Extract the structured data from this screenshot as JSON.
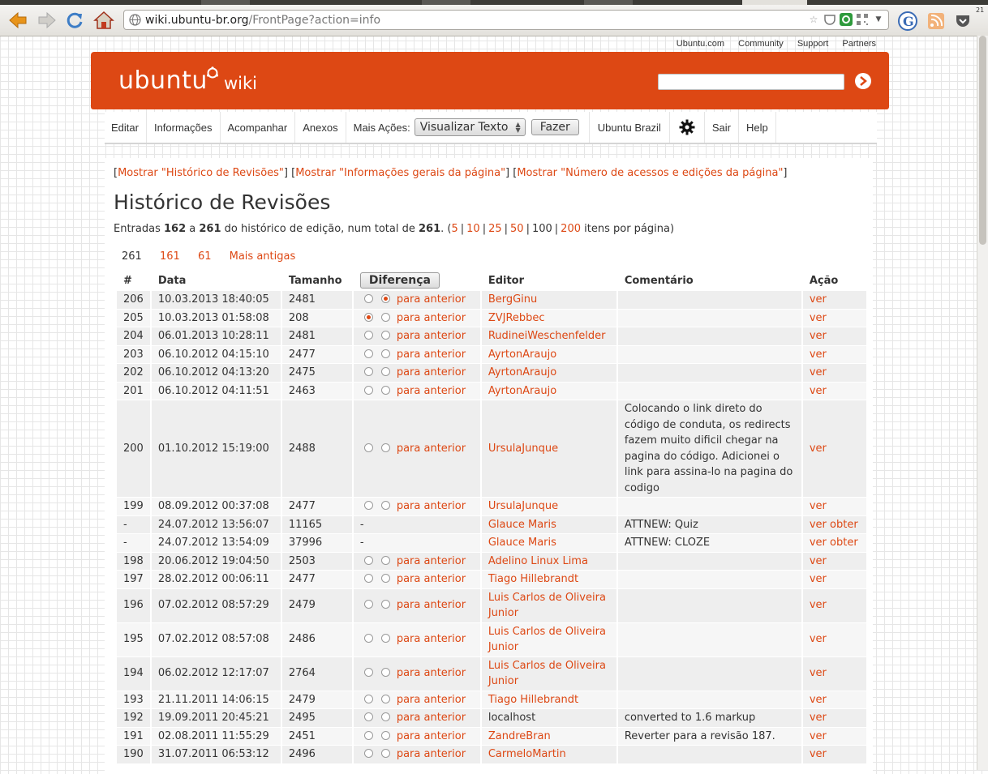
{
  "browser": {
    "url_host": "wiki.ubuntu-br.org",
    "url_path": "/FrontPage?action=info",
    "corner_number": "21"
  },
  "top_links": [
    "Ubuntu.com",
    "Community",
    "Support",
    "Partners"
  ],
  "header": {
    "logo_text": "ubuntu",
    "logo_suffix": "wiki",
    "search_value": ""
  },
  "actionbar": {
    "edit": "Editar",
    "info": "Informações",
    "subscribe": "Acompanhar",
    "attachments": "Anexos",
    "more_actions_label": "Mais Ações:",
    "more_actions_selected": "Visualizar Texto",
    "go_button": "Fazer",
    "ubuntu_brazil": "Ubuntu Brazil",
    "logout": "Sair",
    "help": "Help"
  },
  "content": {
    "toggle_links": [
      "Mostrar \"Histórico de Revisões\"",
      "Mostrar \"Informações gerais da página\"",
      "Mostrar \"Número de acessos e edições da página\""
    ],
    "title": "Histórico de Revisões",
    "entries": {
      "prefix": "Entradas",
      "from": "162",
      "a": "a",
      "to": "261",
      "middle": "do histórico de edição, num total de",
      "total": "261",
      "per_page_options": [
        "5",
        "10",
        "25",
        "50",
        "100",
        "200"
      ],
      "suffix": "itens por página)"
    },
    "pager": {
      "current": "261",
      "p1": "161",
      "p2": "61",
      "older": "Mais antigas"
    },
    "table": {
      "headers": {
        "num": "#",
        "date": "Data",
        "size": "Tamanho",
        "diff_button": "Diferença",
        "editor": "Editor",
        "comment": "Comentário",
        "action": "Ação"
      },
      "diff_label": "para anterior",
      "rows": [
        {
          "num": "206",
          "date": "10.03.2013 18:40:05",
          "size": "2481",
          "editor": "BergGinu",
          "comment": "",
          "action": "ver"
        },
        {
          "num": "205",
          "date": "10.03.2013 01:58:08",
          "size": "208",
          "editor": "ZVJRebbec",
          "comment": "",
          "action": "ver"
        },
        {
          "num": "204",
          "date": "06.01.2013 10:28:11",
          "size": "2481",
          "editor": "RudineiWeschenfelder",
          "comment": "",
          "action": "ver"
        },
        {
          "num": "203",
          "date": "06.10.2012 04:15:10",
          "size": "2477",
          "editor": "AyrtonAraujo",
          "comment": "",
          "action": "ver"
        },
        {
          "num": "202",
          "date": "06.10.2012 04:13:20",
          "size": "2475",
          "editor": "AyrtonAraujo",
          "comment": "",
          "action": "ver"
        },
        {
          "num": "201",
          "date": "06.10.2012 04:11:51",
          "size": "2463",
          "editor": "AyrtonAraujo",
          "comment": "",
          "action": "ver"
        },
        {
          "num": "200",
          "date": "01.10.2012 15:19:00",
          "size": "2488",
          "editor": "UrsulaJunque",
          "comment": "Colocando o link direto do código de conduta, os redirects fazem muito dificil chegar na pagina do código. Adicionei o link para assina-lo na pagina do codigo",
          "action": "ver"
        },
        {
          "num": "199",
          "date": "08.09.2012 00:37:08",
          "size": "2477",
          "editor": "UrsulaJunque",
          "comment": "",
          "action": "ver"
        },
        {
          "num": "-",
          "date": "24.07.2012 13:56:07",
          "size": "11165",
          "editor": "Glauce Maris",
          "comment": "ATTNEW: Quiz",
          "action": "ver",
          "action2": "obter"
        },
        {
          "num": "-",
          "date": "24.07.2012 13:54:09",
          "size": "37996",
          "editor": "Glauce Maris",
          "comment": "ATTNEW: CLOZE",
          "action": "ver",
          "action2": "obter"
        },
        {
          "num": "198",
          "date": "20.06.2012 19:04:50",
          "size": "2503",
          "editor": "Adelino Linux Lima",
          "comment": "",
          "action": "ver"
        },
        {
          "num": "197",
          "date": "28.02.2012 00:06:11",
          "size": "2477",
          "editor": "Tiago Hillebrandt",
          "comment": "",
          "action": "ver"
        },
        {
          "num": "196",
          "date": "07.02.2012 08:57:29",
          "size": "2479",
          "editor": "Luis Carlos de Oliveira Junior",
          "comment": "",
          "action": "ver"
        },
        {
          "num": "195",
          "date": "07.02.2012 08:57:08",
          "size": "2486",
          "editor": "Luis Carlos de Oliveira Junior",
          "comment": "",
          "action": "ver"
        },
        {
          "num": "194",
          "date": "06.02.2012 12:17:07",
          "size": "2764",
          "editor": "Luis Carlos de Oliveira Junior",
          "comment": "",
          "action": "ver"
        },
        {
          "num": "193",
          "date": "21.11.2011 14:06:15",
          "size": "2479",
          "editor": "Tiago Hillebrandt",
          "comment": "",
          "action": "ver"
        },
        {
          "num": "192",
          "date": "19.09.2011 20:45:21",
          "size": "2495",
          "editor": "localhost",
          "comment": "converted to 1.6 markup",
          "action": "ver"
        },
        {
          "num": "191",
          "date": "02.08.2011 11:55:29",
          "size": "2451",
          "editor": "ZandreBran",
          "comment": "Reverter para a revisão 187.",
          "action": "ver"
        },
        {
          "num": "190",
          "date": "31.07.2011 06:53:12",
          "size": "2496",
          "editor": "CarmeloMartin",
          "comment": "",
          "action": "ver"
        }
      ]
    }
  },
  "colors": {
    "accent": "#dd4814",
    "text": "#333333",
    "row_bg": "#eeeeee"
  }
}
